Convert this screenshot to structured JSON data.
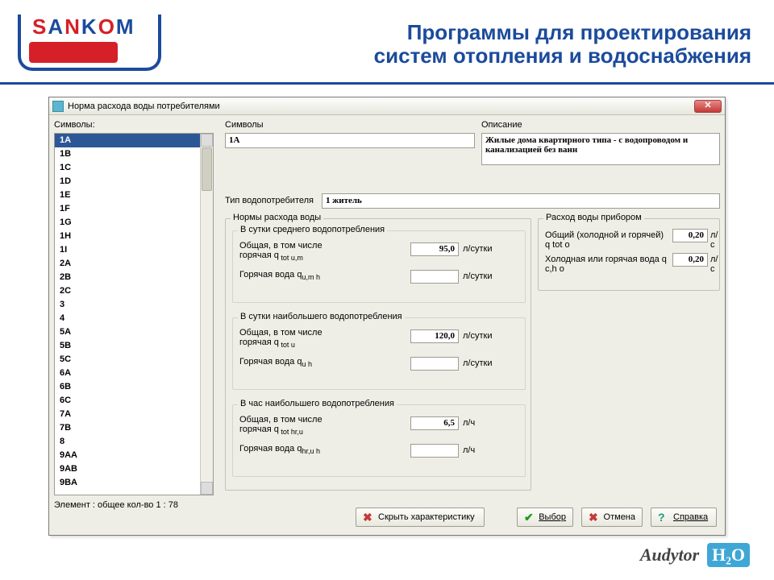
{
  "logo_text": [
    "S",
    "A",
    "N",
    "K",
    "O",
    "M"
  ],
  "page_title_l1": "Программы для проектирования",
  "page_title_l2": "систем отопления и водоснабжения",
  "dialog": {
    "title": "Норма расхода воды потребителями",
    "left_label": "Символы:",
    "mid_label": "Символы",
    "desc_label": "Описание",
    "symbol_value": "1A",
    "description": "Жилые дома квартирного типа - с водопроводом и канализацией без ванн",
    "type_label": "Тип водопотребителя",
    "type_value": "1 житель",
    "list": [
      "1A",
      "1B",
      "1C",
      "1D",
      "1E",
      "1F",
      "1G",
      "1H",
      "1I",
      "2A",
      "2B",
      "2C",
      "3",
      "4",
      "5A",
      "5B",
      "5C",
      "6A",
      "6B",
      "6C",
      "7A",
      "7B",
      "8",
      "9AA",
      "9AB",
      "9BA"
    ],
    "status": "Элемент : общее кол-во 1 : 78",
    "norms_group": "Нормы расхода воды",
    "device_group": "Расход воды прибором",
    "sg_avg": "В сутки среднего водопотребления",
    "sg_max_day": "В сутки наибольшего водопотребления",
    "sg_max_hour": "В час наибольшего водопотребления",
    "lbl_total_hot": "Общая, в том числе горячая q",
    "lbl_hot": "Горячая вода q",
    "sub_tot_um": " tot u,m",
    "sub_h_um": "u,m h",
    "sub_tot_u": " tot u",
    "sub_h_u": "u h",
    "sub_tot_hru": " tot hr,u",
    "sub_h_hru": "hr,u h",
    "unit_lday": "л/сутки",
    "unit_lhour": "л/ч",
    "unit_ls": "л/с",
    "v_avg_total": "95,0",
    "v_avg_hot": "",
    "v_max_total": "120,0",
    "v_max_hot": "",
    "v_hr_total": "6,5",
    "v_hr_hot": "",
    "dev_total_lbl": "Общий (холодной и горячей) q  tot o",
    "dev_cold_lbl": "Холодная или горячая вода q  c,h o",
    "dev_total": "0,20",
    "dev_cold": "0,20",
    "btn_hide": "Скрыть характеристику",
    "btn_choose": "Выбор",
    "btn_cancel": "Отмена",
    "btn_help": "Справка"
  },
  "watermark": "Audytor"
}
